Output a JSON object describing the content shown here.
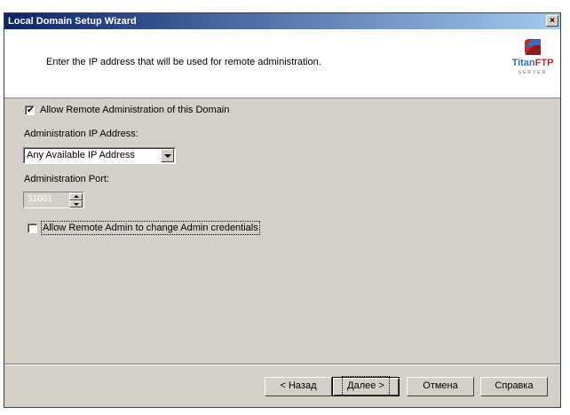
{
  "window": {
    "title": "Local Domain Setup Wizard",
    "close_label": "×"
  },
  "header": {
    "instruction": "Enter the IP address that will be used for remote administration.",
    "logo": {
      "titan": "Titan",
      "ftp": "FTP",
      "sub": "SERVER"
    }
  },
  "form": {
    "allow_remote_admin": {
      "label": "Allow Remote Administration of this Domain",
      "checked": true,
      "mark": "✔"
    },
    "admin_ip_label": "Administration IP Address:",
    "admin_ip_value": "Any Available IP Address",
    "admin_port_label": "Administration Port:",
    "admin_port_value": "31001",
    "allow_change_credentials": {
      "label": "Allow Remote Admin to change Admin credentials",
      "checked": false
    }
  },
  "buttons": {
    "back": "< Назад",
    "next": "Далее >",
    "cancel": "Отмена",
    "help": "Справка"
  }
}
